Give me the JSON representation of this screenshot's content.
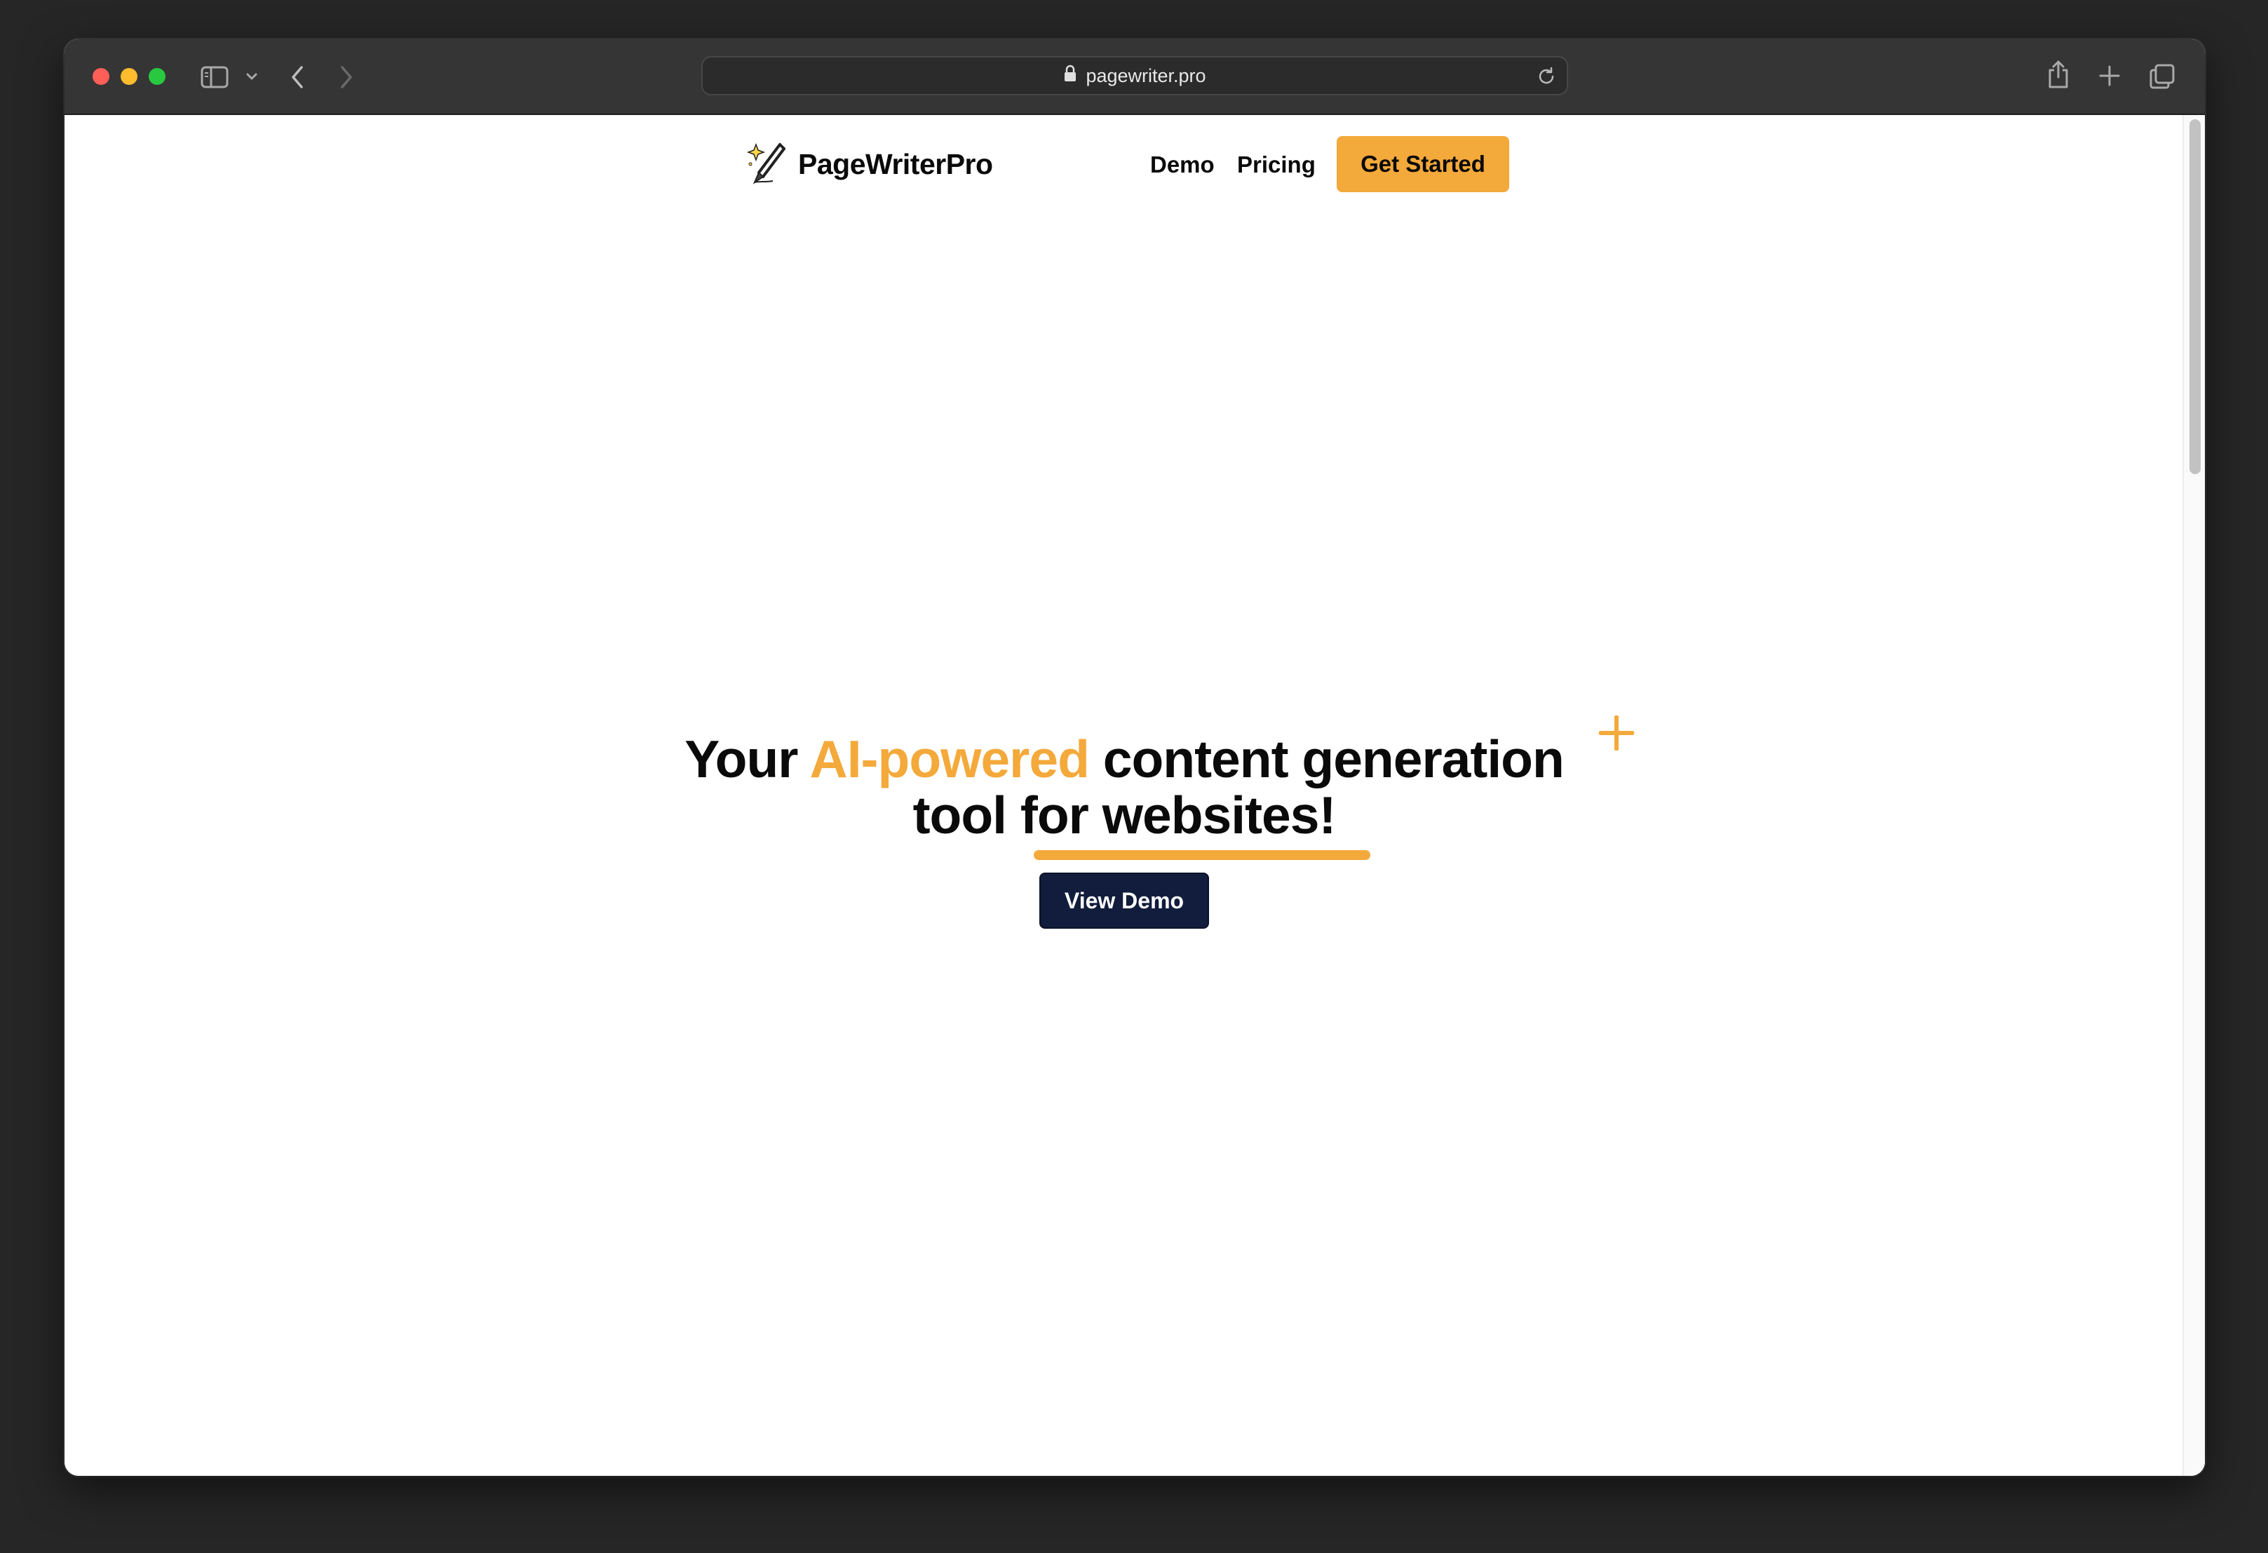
{
  "browser": {
    "url": "pagewriter.pro",
    "icons": {
      "sidebar": "sidebar-icon",
      "dropdown": "chevron-down-icon",
      "back": "chevron-left-icon",
      "forward": "chevron-right-icon",
      "lock": "lock-icon",
      "reload": "reload-icon",
      "share": "share-icon",
      "new_tab": "plus-icon",
      "tabs": "tabs-overview-icon"
    }
  },
  "nav": {
    "brand": "PageWriterPro",
    "logo_icon": "pen-sparkle-icon",
    "links": [
      {
        "label": "Demo"
      },
      {
        "label": "Pricing"
      }
    ],
    "cta_label": "Get Started"
  },
  "hero": {
    "title_part1": "Your ",
    "title_accent": "AI-powered",
    "title_part2": " content generation",
    "title_line2": "tool for websites!",
    "button_label": "View Demo"
  },
  "colors": {
    "accent": "#f4a93b",
    "dark_button": "#121c3c",
    "text": "#0a0a0a"
  }
}
